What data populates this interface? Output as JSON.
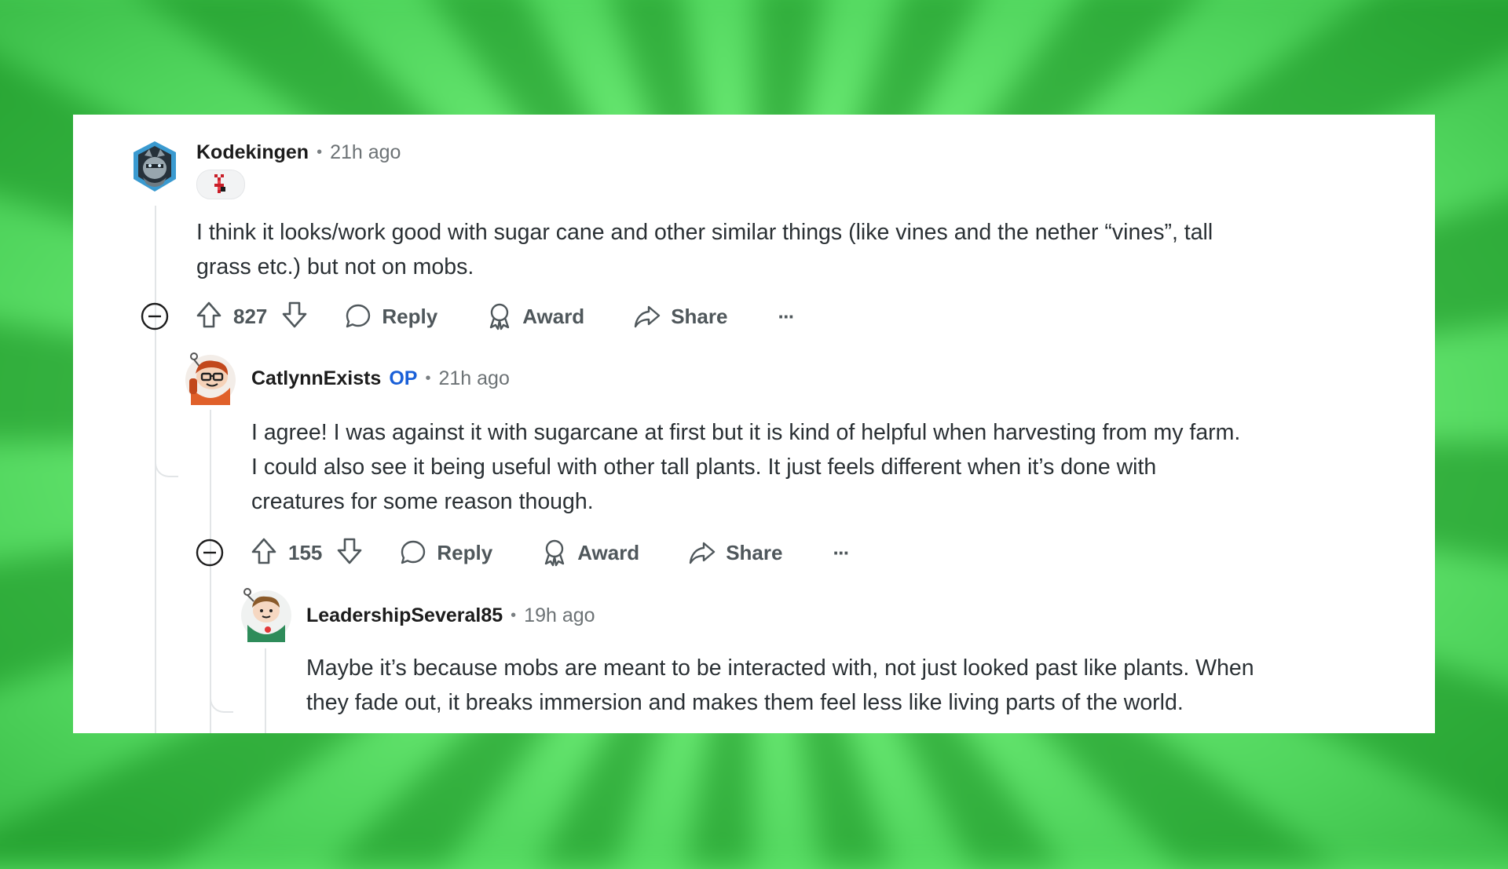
{
  "comments": [
    {
      "author": "Kodekingen",
      "op_badge": "",
      "time": "21h ago",
      "lines": [
        "I think it looks/work good with sugar cane and other similar things (like vines and the nether “vines”, tall",
        "grass etc.) but not on mobs."
      ],
      "score": "827",
      "reply_label": "Reply",
      "award_label": "Award",
      "share_label": "Share",
      "more_label": "···"
    },
    {
      "author": "CatlynnExists",
      "op_badge": "OP",
      "time": "21h ago",
      "lines": [
        "I agree! I was against it with sugarcane at first but it is kind of helpful when harvesting from my farm.",
        "I could also see it being useful with other tall plants. It just feels different when it’s done with",
        "creatures for some reason though."
      ],
      "score": "155",
      "reply_label": "Reply",
      "award_label": "Award",
      "share_label": "Share",
      "more_label": "···"
    },
    {
      "author": "LeadershipSeveral85",
      "op_badge": "",
      "time": "19h ago",
      "lines": [
        "Maybe it’s because mobs are meant to be interacted with, not just looked past like plants. When",
        "they fade out, it breaks immersion and makes them feel less like living parts of the world."
      ]
    }
  ],
  "separator": "•",
  "colors": {
    "background": "#62e86e",
    "op_badge": "#1a60d8",
    "thread_line": "#e2e5e7"
  },
  "icons": [
    "collapse-icon",
    "upvote-icon",
    "downvote-icon",
    "reply-icon",
    "award-icon",
    "share-icon",
    "more-icon"
  ]
}
